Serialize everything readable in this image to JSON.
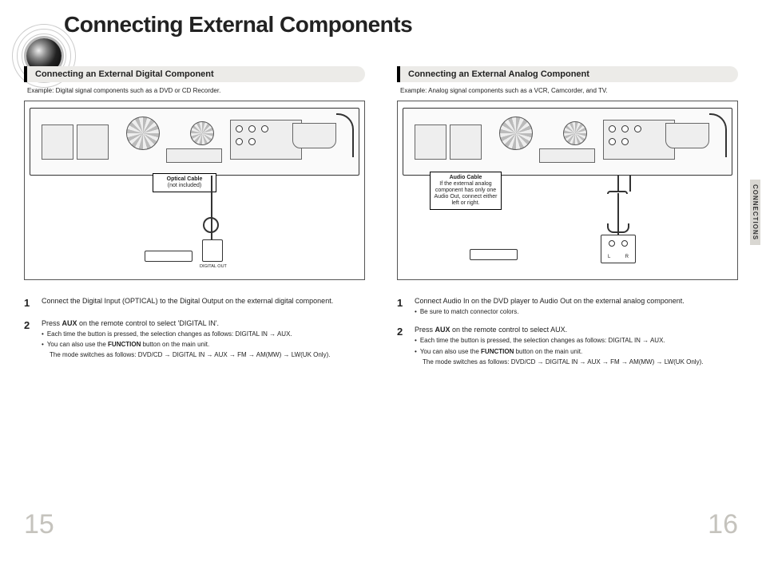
{
  "title": "Connecting External Components",
  "side_tab": "CONNECTIONS",
  "page_left": "15",
  "page_right": "16",
  "left": {
    "heading": "Connecting an External Digital Component",
    "example": "Example: Digital signal components such as a DVD or CD Recorder.",
    "callout_title": "Optical Cable",
    "callout_sub": "(not included)",
    "digital_out_label": "DIGITAL OUT",
    "steps": [
      {
        "num": "1",
        "text": "Connect the Digital Input (OPTICAL) to the Digital Output on the external digital component."
      },
      {
        "num": "2",
        "text_pre": "Press ",
        "text_bold": "AUX",
        "text_post": " on the remote control to select 'DIGITAL IN'.",
        "bullets": [
          "Each time the button is pressed, the selection changes as follows: DIGITAL IN → AUX."
        ],
        "also_pre": "You can also use the ",
        "also_bold": "FUNCTION",
        "also_post": " button on the main unit.",
        "mode_line": "The mode switches as follows: DVD/CD → DIGITAL IN → AUX → FM → AM(MW) → LW(UK Only)."
      }
    ]
  },
  "right": {
    "heading": "Connecting an External Analog Component",
    "example": "Example: Analog signal components such as a VCR, Camcorder, and TV.",
    "callout_title": "Audio Cable",
    "callout_body": "If the external analog component has only one Audio Out, connect either left or right.",
    "rca_L": "L",
    "rca_R": "R",
    "steps": [
      {
        "num": "1",
        "text": "Connect Audio In on the DVD player to Audio Out on the external analog component.",
        "bullets": [
          "Be sure to match connector colors."
        ]
      },
      {
        "num": "2",
        "text_pre": "Press ",
        "text_bold": "AUX",
        "text_post": " on the remote control to select AUX.",
        "bullets": [
          "Each time the button is pressed, the selection changes as follows: DIGITAL IN → AUX."
        ],
        "also_pre": "You can also use the ",
        "also_bold": "FUNCTION",
        "also_post": " button on the main unit.",
        "mode_line": "The mode switches as follows: DVD/CD → DIGITAL IN → AUX → FM → AM(MW) → LW(UK Only)."
      }
    ]
  }
}
